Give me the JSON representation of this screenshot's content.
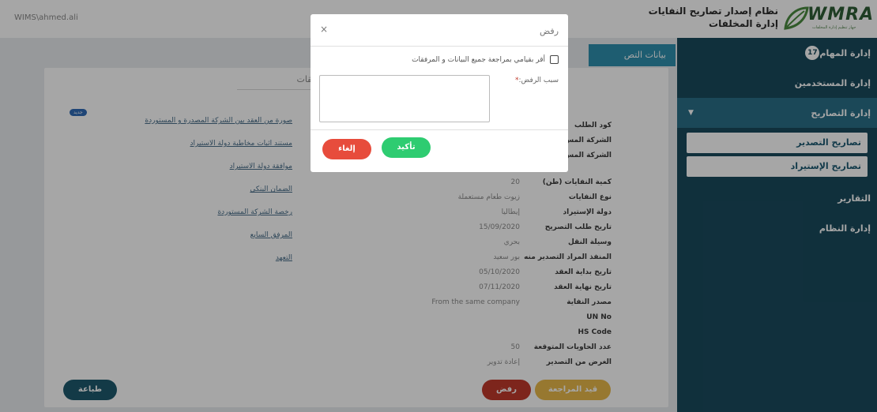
{
  "header": {
    "username": "WIMS\\ahmed.ali",
    "system_title": "نظام إصدار تصاريح النفايات",
    "department": "إدارة المخلفات",
    "logo_text": "WMRA",
    "logo_tagline": "جهاز تنظيم إدارة المخلفات"
  },
  "sidebar": {
    "tasks_label": "إدارة المهام",
    "tasks_count": "17",
    "users_label": "إدارة المستخدمين",
    "permits_label": "إدارة التصاريح",
    "permits_sub": [
      "تصاريح التصدير",
      "تصاريح الإستيراد"
    ],
    "reports_label": "التقارير",
    "system_label": "إدارة النظام"
  },
  "main": {
    "tab_label": "بيانات التص",
    "attachments_title": "فقات",
    "new_badge": "جديد",
    "fields": [
      {
        "label": "كود الطلب",
        "value": ""
      },
      {
        "label": "الشركة المس",
        "value": ""
      },
      {
        "label": "الشركة المس (الإنجليزية)",
        "value": ""
      },
      {
        "label": "كمية النفايات (طن)",
        "value": "20"
      },
      {
        "label": "نوع النفايات",
        "value": "زيوت طعام مستعملة"
      },
      {
        "label": "دولة الإستيراد",
        "value": "إيطاليا"
      },
      {
        "label": "تاريخ طلب التصريح",
        "value": "15/09/2020"
      },
      {
        "label": "وسيلة النقل",
        "value": "بحري"
      },
      {
        "label": "المنفذ المراد التصدير منه",
        "value": "بور سعيد"
      },
      {
        "label": "تاريخ بداية العقد",
        "value": "05/10/2020"
      },
      {
        "label": "تاريخ نهاية العقد",
        "value": "07/11/2020"
      },
      {
        "label": "مصدر النفاية",
        "value": "From the same company"
      },
      {
        "label": "UN No",
        "value": ""
      },
      {
        "label": "HS Code",
        "value": ""
      },
      {
        "label": "عدد الحاويات المتوقعة",
        "value": "50"
      },
      {
        "label": "الغرض من التصدير",
        "value": "إعادة تدوير"
      }
    ],
    "attachments": [
      "صورة من العقد بين الشركة المصدرة و المستوردة",
      "مستند اثبات مخاطبة دولة الاستيراد",
      "موافقة دولة الاستيراد",
      "الضمان البنكي",
      "رخصة الشركة المستوردة",
      "المرفق السابع",
      "التعهد"
    ],
    "btn_under_review": "قيد المراجعة",
    "btn_reject": "رفض",
    "btn_print": "طباعة"
  },
  "modal": {
    "title": "رفض",
    "close": "×",
    "checkbox_label": "أقر بقيامي بمراجعة جميع البيانات و المرفقات",
    "reason_label": "سبب الرفض:",
    "reason_required": "*",
    "reason_value": "",
    "btn_confirm": "تأكيد",
    "btn_cancel": "إلغاء"
  },
  "colors": {
    "sidebar": "#1a4a5d",
    "sidebar_active": "#2a6f88",
    "accent_tab": "#2e8fae",
    "confirm": "#2ecc71",
    "cancel": "#e74c3c",
    "review": "#e8b84a",
    "reject": "#c0392b",
    "print": "#1e5a6e"
  }
}
